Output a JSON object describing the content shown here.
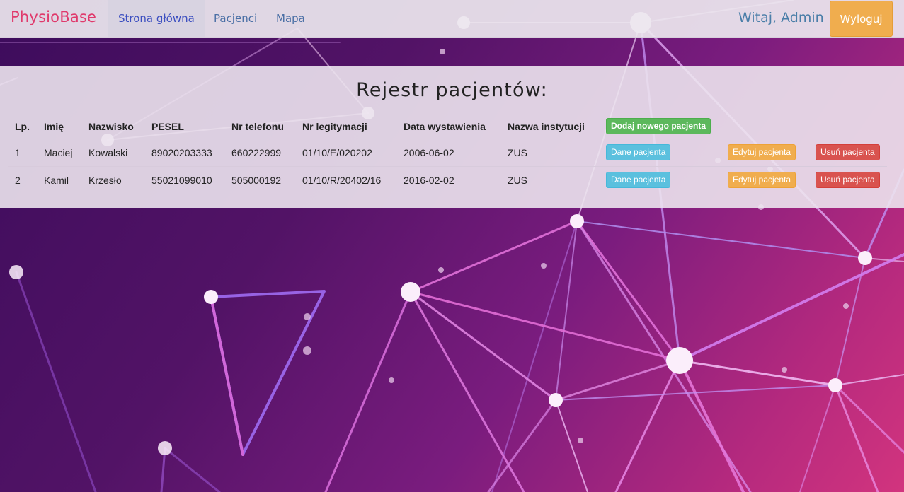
{
  "brand": "PhysioBase",
  "nav": {
    "items": [
      {
        "label": "Strona główna",
        "active": true
      },
      {
        "label": "Pacjenci",
        "active": false
      },
      {
        "label": "Mapa",
        "active": false
      }
    ],
    "greeting": "Witaj, Admin",
    "logout_label": "Wyloguj"
  },
  "panel": {
    "title": "Rejestr pacjentów:",
    "add_button_label": "Dodaj nowego pacjenta",
    "columns": [
      "Lp.",
      "Imię",
      "Nazwisko",
      "PESEL",
      "Nr telefonu",
      "Nr legitymacji",
      "Data wystawienia",
      "Nazwa instytucji"
    ],
    "rows": [
      {
        "lp": "1",
        "first_name": "Maciej",
        "last_name": "Kowalski",
        "pesel": "89020203333",
        "phone": "660222999",
        "id_number": "01/10/E/020202",
        "issue_date": "2006-06-02",
        "institution": "ZUS"
      },
      {
        "lp": "2",
        "first_name": "Kamil",
        "last_name": "Krzesło",
        "pesel": "55021099010",
        "phone": "505000192",
        "id_number": "01/10/R/20402/16",
        "issue_date": "2016-02-02",
        "institution": "ZUS"
      }
    ],
    "row_actions": {
      "details": "Dane pacjenta",
      "edit": "Edytuj pacjenta",
      "delete": "Usuń pacjenta"
    }
  },
  "colors": {
    "brand": "#e0396b",
    "nav_link": "#4a6fa5",
    "logout": "#f0ad4e",
    "success": "#5cb85c",
    "info": "#5bc0de",
    "warning": "#f0ad4e",
    "danger": "#d9534f",
    "background_start": "#3d0c5c",
    "background_end": "#d2347e"
  }
}
